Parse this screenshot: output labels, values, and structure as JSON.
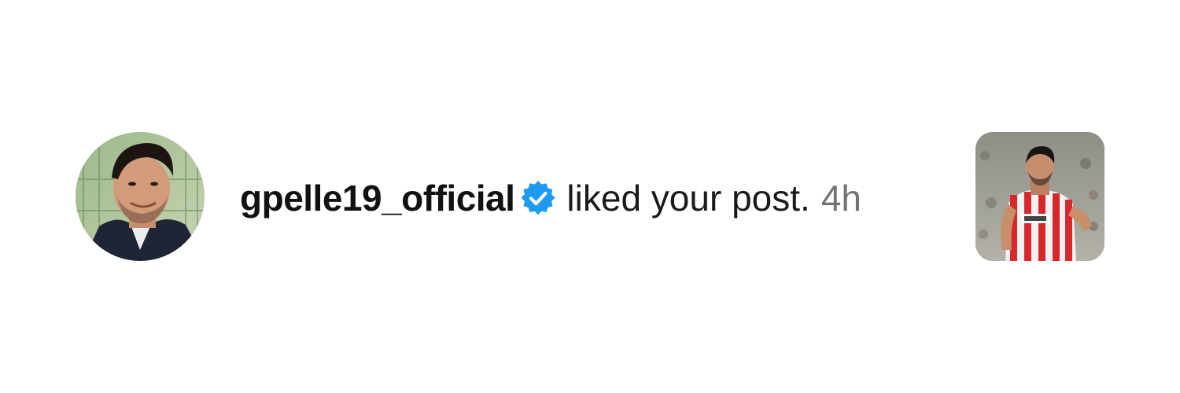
{
  "notification": {
    "username": "gpelle19_official",
    "verified": true,
    "action_text": "liked your post.",
    "timestamp": "4h",
    "avatar_icon": "profile-photo",
    "badge_icon": "verified-badge-icon",
    "post_thumbnail_icon": "post-thumbnail-photo",
    "colors": {
      "username": "#111111",
      "action": "#1a1a1a",
      "timestamp": "#737373",
      "verified_badge": "#1d9bf0",
      "background": "#ffffff"
    }
  }
}
